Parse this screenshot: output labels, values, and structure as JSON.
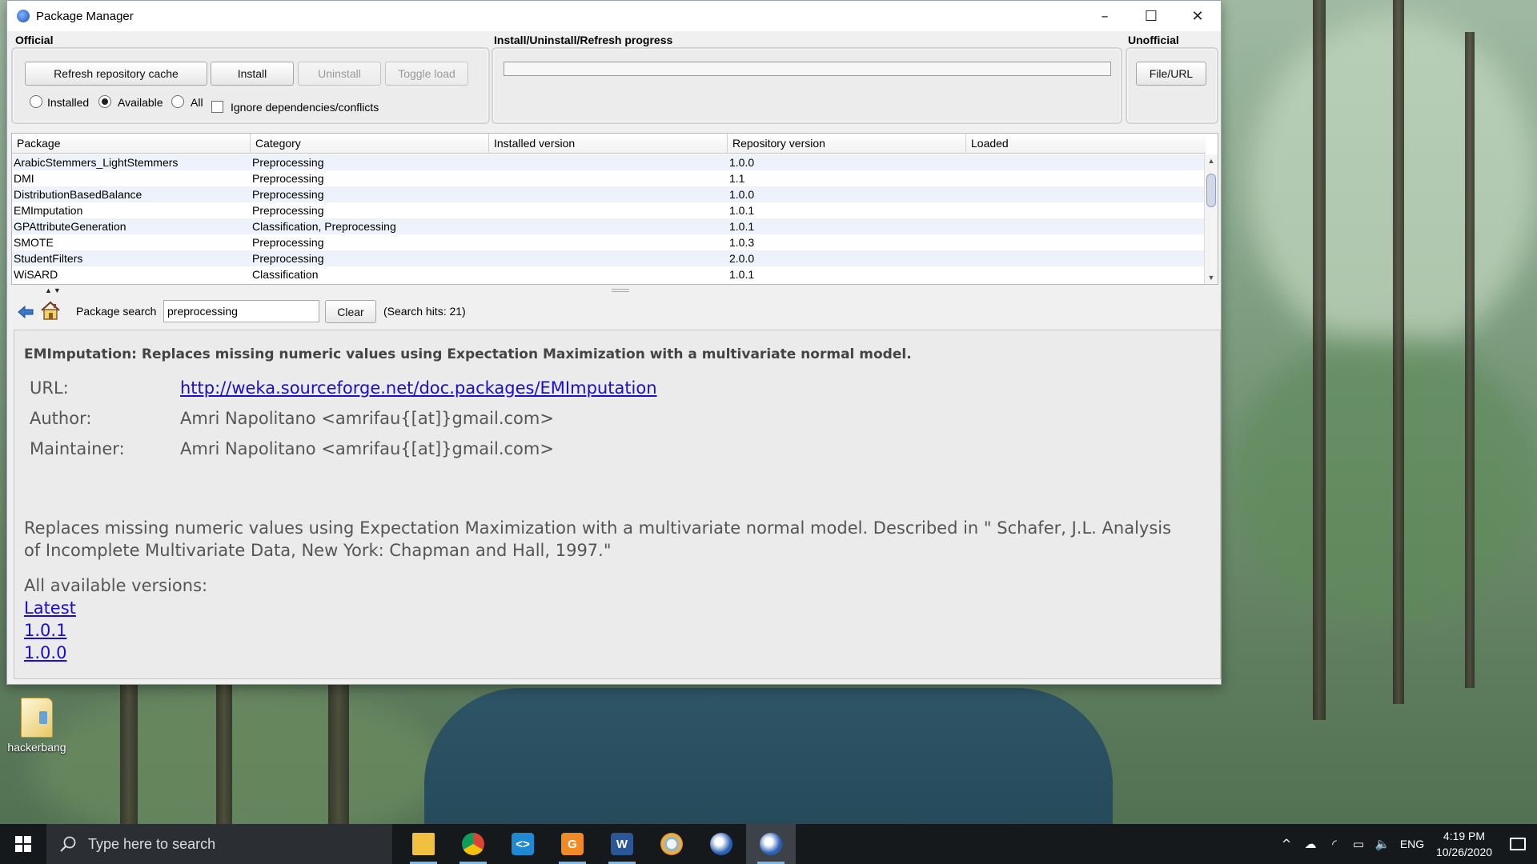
{
  "window": {
    "title": "Package Manager",
    "minimize": "–",
    "maximize": "☐",
    "close": "✕"
  },
  "official": {
    "label": "Official",
    "refresh_button": "Refresh repository cache",
    "install_button": "Install",
    "uninstall_button": "Uninstall",
    "toggle_load_button": "Toggle load",
    "radio_installed": "Installed",
    "radio_available": "Available",
    "radio_all": "All",
    "selected_filter": "Available",
    "ignore_deps": "Ignore dependencies/conflicts",
    "ignore_deps_checked": false
  },
  "progress": {
    "label": "Install/Uninstall/Refresh progress",
    "value": 0
  },
  "unofficial": {
    "label": "Unofficial",
    "file_url_button": "File/URL"
  },
  "table": {
    "columns": [
      "Package",
      "Category",
      "Installed version",
      "Repository version",
      "Loaded"
    ],
    "rows": [
      [
        "ArabicStemmers_LightStemmers",
        "Preprocessing",
        "",
        "1.0.0",
        ""
      ],
      [
        "DMI",
        "Preprocessing",
        "",
        "1.1",
        ""
      ],
      [
        "DistributionBasedBalance",
        "Preprocessing",
        "",
        "1.0.0",
        ""
      ],
      [
        "EMImputation",
        "Preprocessing",
        "",
        "1.0.1",
        ""
      ],
      [
        "GPAttributeGeneration",
        "Classification, Preprocessing",
        "",
        "1.0.1",
        ""
      ],
      [
        "SMOTE",
        "Preprocessing",
        "",
        "1.0.3",
        ""
      ],
      [
        "StudentFilters",
        "Preprocessing",
        "",
        "2.0.0",
        ""
      ],
      [
        "WiSARD",
        "Classification",
        "",
        "1.0.1",
        ""
      ]
    ],
    "selected_row": 3
  },
  "search": {
    "label": "Package search",
    "value": "preprocessing",
    "clear_button": "Clear",
    "hits": "(Search hits: 21)"
  },
  "info": {
    "heading": "EMImputation: Replaces missing numeric values using Expectation Maximization with a multivariate normal model.",
    "url_key": "URL:",
    "url_value": "http://weka.sourceforge.net/doc.packages/EMImputation",
    "author_key": "Author:",
    "author_value": "Amri Napolitano <amrifau{[at]}gmail.com>",
    "maintainer_key": "Maintainer:",
    "maintainer_value": "Amri Napolitano <amrifau{[at]}gmail.com>",
    "description": "Replaces missing numeric values using Expectation Maximization with a multivariate normal model. Described in \" Schafer, J.L. Analysis of Incomplete Multivariate Data, New York: Chapman and Hall, 1997.\"",
    "versions_label": "All available versions:",
    "versions": [
      "Latest",
      "1.0.1",
      "1.0.0"
    ]
  },
  "desktop": {
    "icon_label": "hackerbang"
  },
  "taskbar": {
    "search_placeholder": "Type here to search",
    "apps": [
      "file-explorer",
      "chrome",
      "vscode",
      "pdf-editor",
      "word",
      "paint",
      "weka",
      "weka-active"
    ],
    "language": "ENG",
    "time": "4:19 PM",
    "date": "10/26/2020"
  },
  "colors": {
    "link": "#1a0dcc",
    "taskbar": "#15191c",
    "accent": "#76b9ed"
  }
}
